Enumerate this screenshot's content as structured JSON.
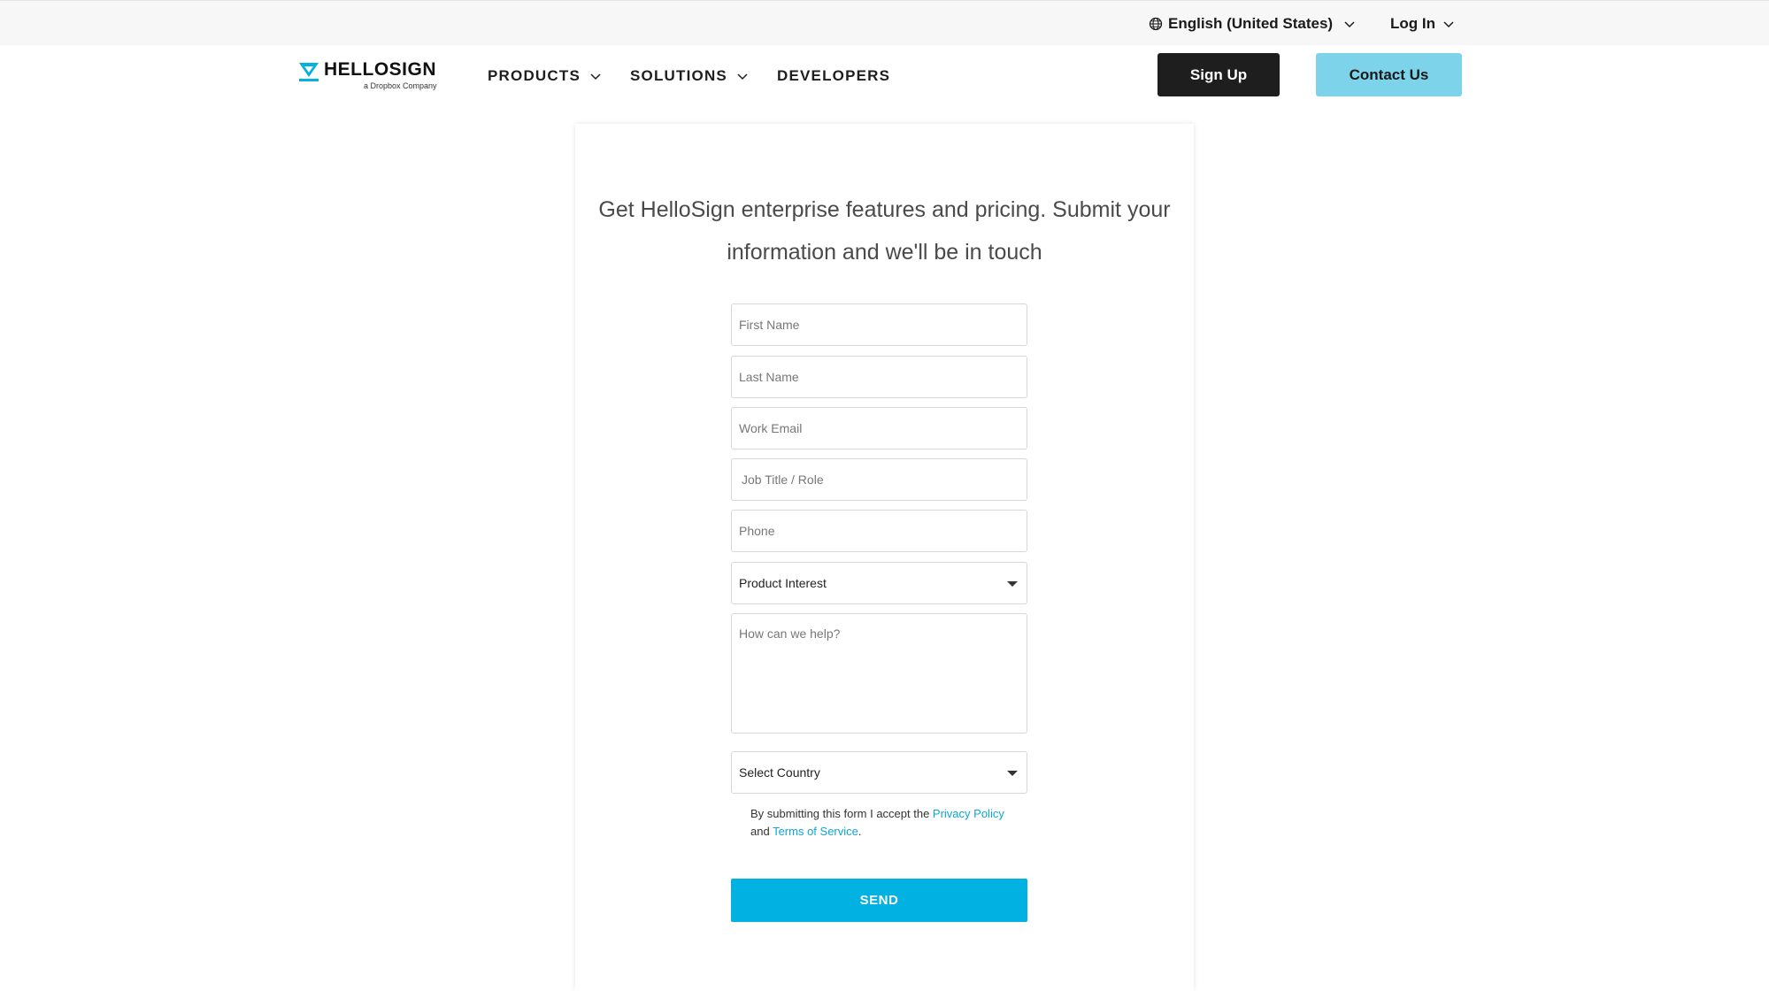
{
  "utility_bar": {
    "language": "English (United States)",
    "login": "Log In"
  },
  "nav": {
    "logo_word": "HELLOSIGN",
    "logo_sub": "a Dropbox Company",
    "items": [
      {
        "label": "PRODUCTS"
      },
      {
        "label": "SOLUTIONS"
      },
      {
        "label": "DEVELOPERS"
      }
    ],
    "signup_label": "Sign Up",
    "contact_label": "Contact Us"
  },
  "form": {
    "headline": "Get HelloSign enterprise features and pricing. Submit your information and we'll be in touch",
    "first_name_placeholder": "First Name",
    "last_name_placeholder": "Last Name",
    "work_email_placeholder": "Work Email",
    "job_title_placeholder": "Job Title / Role",
    "phone_placeholder": "Phone",
    "product_interest": "Product Interest",
    "help_placeholder": "How can we help?",
    "country": "Select Country",
    "consent_prefix": "By submitting this form I accept the ",
    "privacy_link": "Privacy Policy",
    "consent_and": " and ",
    "terms_link": "Terms of Service",
    "consent_suffix": ".",
    "send_label": "SEND"
  },
  "colors": {
    "brand_blue": "#00b1e1",
    "contact_button": "#7dd3ea",
    "signup_button": "#1e1e1e",
    "link": "#0ea5d8"
  }
}
